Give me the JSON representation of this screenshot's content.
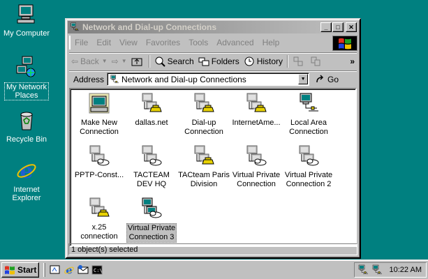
{
  "desktop": {
    "icons": [
      {
        "label_line1": "My Computer",
        "label_line2": ""
      },
      {
        "label_line1": "My Network",
        "label_line2": "Places"
      },
      {
        "label_line1": "Recycle Bin",
        "label_line2": ""
      },
      {
        "label_line1": "Internet",
        "label_line2": "Explorer"
      }
    ]
  },
  "window": {
    "title": "Network and Dial-up Connections",
    "menu": [
      "File",
      "Edit",
      "View",
      "Favorites",
      "Tools",
      "Advanced",
      "Help"
    ],
    "toolbar": {
      "back": "Back",
      "search": "Search",
      "folders": "Folders",
      "history": "History",
      "more": "»"
    },
    "address": {
      "label": "Address",
      "value": "Network and Dial-up Connections",
      "go": "Go"
    },
    "items": [
      {
        "line1": "Make New",
        "line2": "Connection",
        "icon": "make-new-connection-icon"
      },
      {
        "line1": "dallas.net",
        "line2": "",
        "icon": "dialup-connection-icon"
      },
      {
        "line1": "Dial-up",
        "line2": "Connection",
        "icon": "dialup-connection-icon"
      },
      {
        "line1": "InternetAme...",
        "line2": "",
        "icon": "dialup-connection-icon"
      },
      {
        "line1": "Local Area",
        "line2": "Connection",
        "icon": "lan-connection-icon"
      },
      {
        "line1": "PPTP-Const...",
        "line2": "",
        "icon": "vpn-connection-icon"
      },
      {
        "line1": "TACTEAM",
        "line2": "DEV HQ",
        "icon": "vpn-connection-icon"
      },
      {
        "line1": "TACteam Paris",
        "line2": "Division",
        "icon": "dialup-connection-icon"
      },
      {
        "line1": "Virtual Private",
        "line2": "Connection",
        "icon": "vpn-connection-icon"
      },
      {
        "line1": "Virtual Private",
        "line2": "Connection 2",
        "icon": "vpn-connection-icon"
      },
      {
        "line1": "x.25",
        "line2": "connection",
        "icon": "dialup-connection-icon"
      },
      {
        "line1": "Virtual Private",
        "line2": "Connection 3",
        "icon": "vpn-connection-icon"
      }
    ],
    "status": "1 object(s) selected"
  },
  "taskbar": {
    "start": "Start",
    "clock": "10:22 AM"
  },
  "colors": {
    "desktop": "#008080",
    "inactive_title_start": "#808080",
    "inactive_title_end": "#c0c0c0",
    "chrome": "#c0c0c0"
  }
}
